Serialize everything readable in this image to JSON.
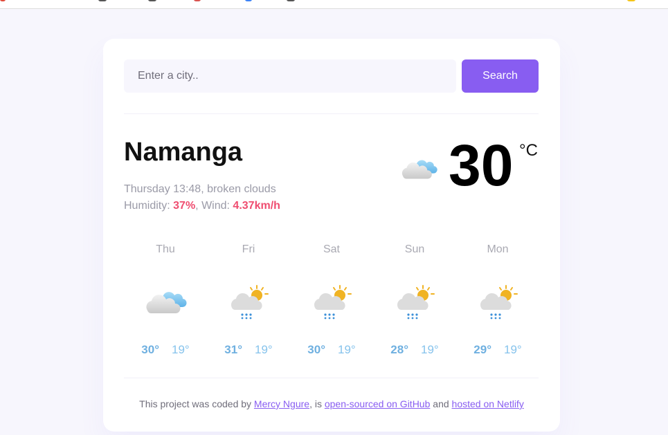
{
  "search": {
    "placeholder": "Enter a city..",
    "button_label": "Search"
  },
  "current": {
    "city": "Namanga",
    "day_time": "Thursday 13:48",
    "description": "broken clouds",
    "humidity_label": "Humidity:",
    "humidity_value": "37%",
    "wind_label": "Wind:",
    "wind_value": "4.37km/h",
    "temperature": "30",
    "unit": "°C",
    "icon": "broken-clouds-icon"
  },
  "forecast": [
    {
      "day": "Thu",
      "max": "30°",
      "min": "19°",
      "icon": "broken-clouds-icon"
    },
    {
      "day": "Fri",
      "max": "31°",
      "min": "19°",
      "icon": "sun-rain-cloud-icon"
    },
    {
      "day": "Sat",
      "max": "30°",
      "min": "19°",
      "icon": "sun-rain-cloud-icon"
    },
    {
      "day": "Sun",
      "max": "28°",
      "min": "19°",
      "icon": "sun-rain-cloud-icon"
    },
    {
      "day": "Mon",
      "max": "29°",
      "min": "19°",
      "icon": "sun-rain-cloud-icon"
    }
  ],
  "footer": {
    "prefix": "This project was coded by",
    "author_link": "Mercy Ngure",
    "middle": ", is",
    "github_link": "open-sourced on GitHub",
    "and": "and",
    "netlify_link": "hosted on Netlify"
  },
  "colors": {
    "accent": "#885df1",
    "highlight": "#ef4d70",
    "forecast_max": "#6fb0e0",
    "forecast_min": "#86c3ec",
    "background": "#f7f6fd"
  }
}
